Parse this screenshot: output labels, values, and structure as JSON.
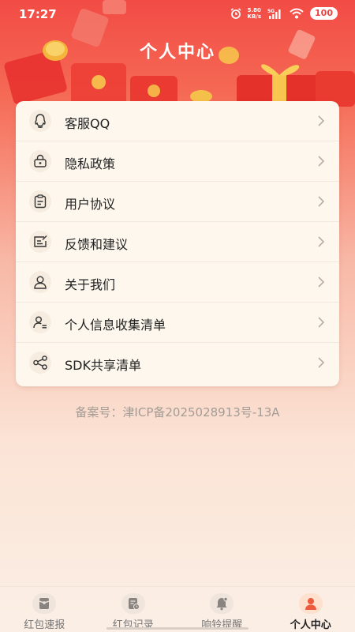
{
  "status_bar": {
    "time": "17:27",
    "net_speed_value": "5.80",
    "net_speed_unit": "KB/s",
    "network": "5G",
    "battery": "100"
  },
  "header": {
    "title": "个人中心"
  },
  "menu": {
    "items": [
      {
        "label": "客服QQ",
        "icon": "qq-icon"
      },
      {
        "label": "隐私政策",
        "icon": "lock-icon"
      },
      {
        "label": "用户协议",
        "icon": "clipboard-icon"
      },
      {
        "label": "反馈和建议",
        "icon": "feedback-icon"
      },
      {
        "label": "关于我们",
        "icon": "person-icon"
      },
      {
        "label": "个人信息收集清单",
        "icon": "person-list-icon"
      },
      {
        "label": "SDK共享清单",
        "icon": "share-icon"
      }
    ]
  },
  "icp": "备案号：津ICP备2025028913号-13A",
  "bottom_nav": {
    "items": [
      {
        "label": "红包速报",
        "icon": "red-packet-icon",
        "active": false
      },
      {
        "label": "红包记录",
        "icon": "record-icon",
        "active": false
      },
      {
        "label": "响铃提醒",
        "icon": "bell-icon",
        "active": false
      },
      {
        "label": "个人中心",
        "icon": "user-icon",
        "active": true
      }
    ]
  },
  "colors": {
    "header_red": "#f24b45",
    "card_bg": "#fdf7ee",
    "icp_text": "#a39b94",
    "active_icon": "#ee5a3e"
  }
}
